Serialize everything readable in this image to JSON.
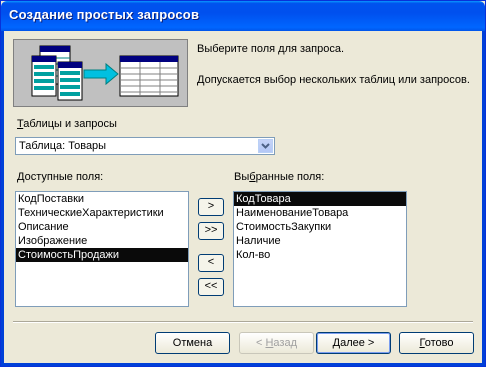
{
  "window": {
    "title": "Создание простых запросов"
  },
  "description": {
    "line1": "Выберите поля для запроса.",
    "line2": "Допускается выбор нескольких таблиц или запросов."
  },
  "tables_label": {
    "accel": "Т",
    "rest": "аблицы и запросы"
  },
  "combo": {
    "value": "Таблица: Товары"
  },
  "available": {
    "label_accel": "Д",
    "label_rest": "оступные поля:",
    "items": [
      "КодПоставки",
      "ТехническиеХарактеристики",
      "Описание",
      "Изображение",
      "СтоимостьПродажи"
    ],
    "selected_index": 4
  },
  "chosen": {
    "label_pre": "Вы",
    "label_accel": "б",
    "label_rest": "ранные поля:",
    "items": [
      "КодТовара",
      "НаименованиеТовара",
      "СтоимостьЗакупки",
      "Наличие",
      "Кол-во"
    ],
    "selected_index": 0
  },
  "move_buttons": {
    "add_one": ">",
    "add_all": ">>",
    "remove_one": "<",
    "remove_all": "<<"
  },
  "buttons": {
    "cancel": "Отмена",
    "back_pre": "< ",
    "back_accel": "Н",
    "back_rest": "азад",
    "next_accel": "Д",
    "next_rest": "алее >",
    "finish_accel": "Г",
    "finish_rest": "отово"
  },
  "colors": {
    "title_bar": "#0055ea",
    "dialog_bg": "#ece9d8",
    "selection": "#0a0a0a",
    "arrow": "#00c0e0"
  }
}
